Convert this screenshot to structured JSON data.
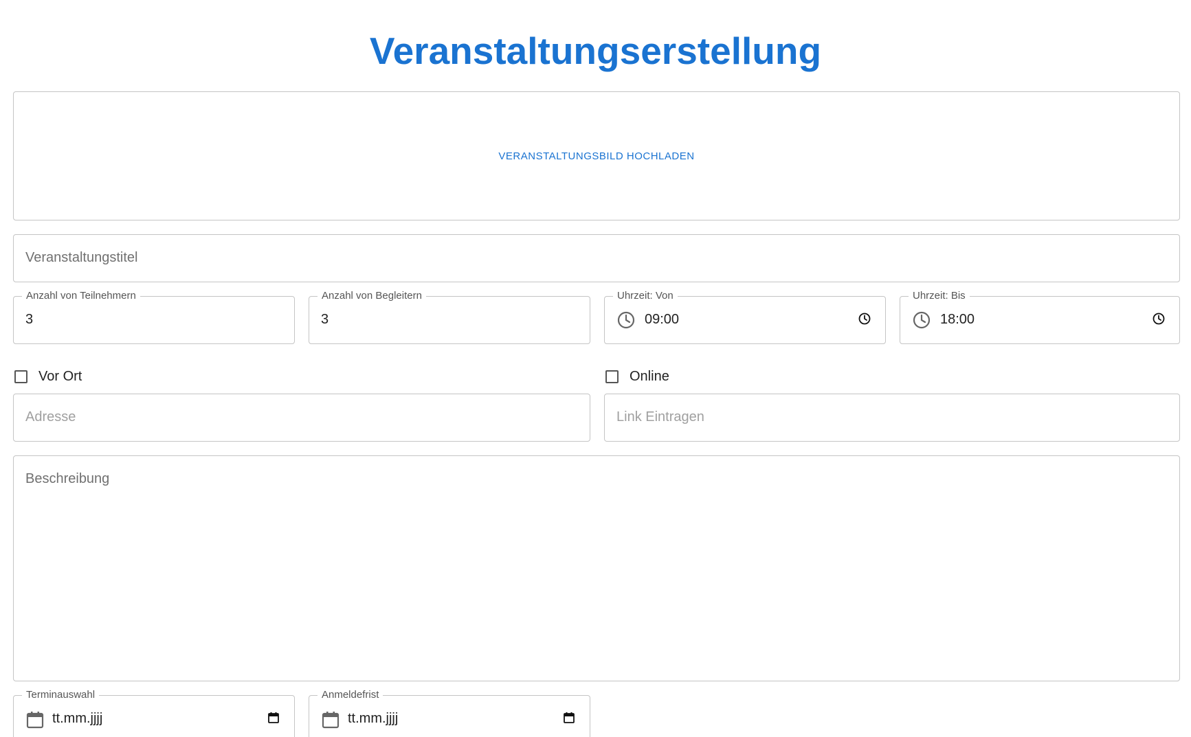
{
  "header": {
    "title": "Veranstaltungserstellung"
  },
  "upload": {
    "label": "VERANSTALTUNGSBILD HOCHLADEN"
  },
  "fields": {
    "title": {
      "placeholder": "Veranstaltungstitel"
    },
    "participants": {
      "label": "Anzahl von Teilnehmern",
      "value": "3"
    },
    "companions": {
      "label": "Anzahl von Begleitern",
      "value": "3"
    },
    "time_from": {
      "label": "Uhrzeit: Von",
      "value": "09:00"
    },
    "time_to": {
      "label": "Uhrzeit: Bis",
      "value": "18:00"
    },
    "address": {
      "placeholder": "Adresse"
    },
    "link": {
      "placeholder": "Link Eintragen"
    },
    "description": {
      "placeholder": "Beschreibung"
    },
    "date": {
      "label": "Terminauswahl",
      "value": "tt.mm.jjjj"
    },
    "deadline": {
      "label": "Anmeldefrist",
      "value": "tt.mm.jjjj"
    }
  },
  "checkboxes": {
    "on_site": {
      "label": "Vor Ort",
      "checked": false
    },
    "online": {
      "label": "Online",
      "checked": false
    }
  },
  "colors": {
    "accent": "#1a73d1",
    "border": "#c4c4c4",
    "text": "#222222"
  },
  "icons": {
    "time_left": "clock-icon",
    "time_right": "clock-small-icon",
    "date_left": "calendar-icon",
    "date_right": "calendar-small-icon"
  }
}
